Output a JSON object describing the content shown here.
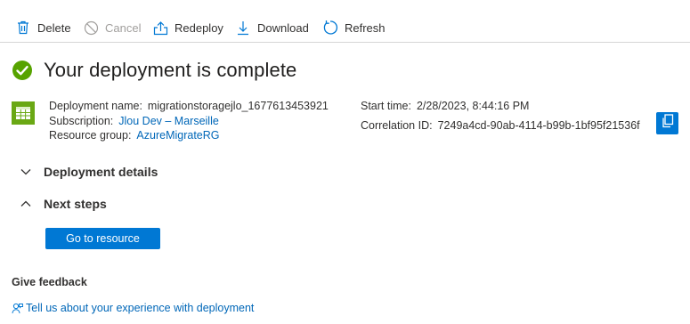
{
  "toolbar": {
    "delete_label": "Delete",
    "cancel_label": "Cancel",
    "redeploy_label": "Redeploy",
    "download_label": "Download",
    "refresh_label": "Refresh"
  },
  "status": {
    "title": "Your deployment is complete",
    "icon": "success-check-icon",
    "color": "#57a300"
  },
  "details": {
    "deployment_name_label": "Deployment name:",
    "deployment_name": "migrationstoragejlo_1677613453921",
    "subscription_label": "Subscription:",
    "subscription": "Jlou Dev – Marseille",
    "resource_group_label": "Resource group:",
    "resource_group": "AzureMigrateRG",
    "start_time_label": "Start time:",
    "start_time": "2/28/2023, 8:44:16 PM",
    "correlation_id_label": "Correlation ID:",
    "correlation_id": "7249a4cd-90ab-4114-b99b-1bf95f21536f"
  },
  "sections": {
    "deployment_details": "Deployment details",
    "next_steps": "Next steps"
  },
  "actions": {
    "go_to_resource": "Go to resource"
  },
  "feedback": {
    "title": "Give feedback",
    "link": "Tell us about your experience with deployment"
  },
  "colors": {
    "accent": "#0078d4",
    "link": "#0067b8",
    "success": "#57a300"
  }
}
